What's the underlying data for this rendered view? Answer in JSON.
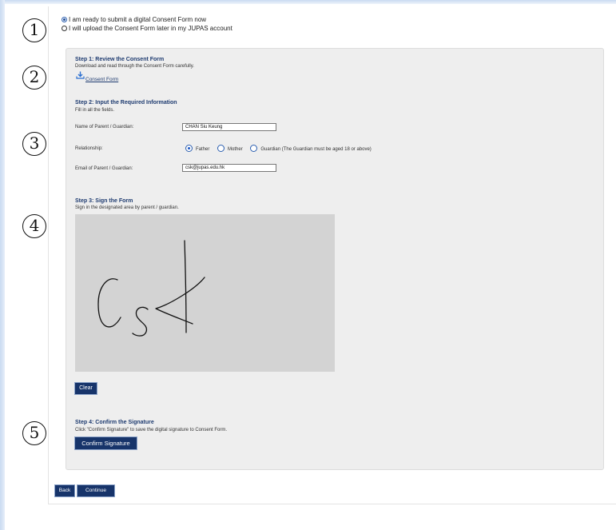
{
  "options": {
    "submit_now": "I am ready to submit a digital Consent Form now",
    "upload_later": "I will upload the Consent Form later in my JUPAS account"
  },
  "markers": [
    "1",
    "2",
    "3",
    "4",
    "5"
  ],
  "step1": {
    "title": "Step 1: Review the Consent Form",
    "desc": "Download and read through the Consent Form carefully.",
    "link": "Consent Form",
    "icon": "download-icon"
  },
  "step2": {
    "title": "Step 2: Input the Required Information",
    "desc": "Fill in all the fields.",
    "name_label": "Name of Parent / Guardian:",
    "name_value": "CHAN Siu Keung",
    "relationship_label": "Relationship:",
    "relationship_options": [
      "Father",
      "Mother",
      "Guardian (The Guardian must be aged 18 or above)"
    ],
    "relationship_selected": "Father",
    "email_label": "Email of Parent / Guardian:",
    "email_value": "csk@jupas.edu.hk"
  },
  "step3": {
    "title": "Step 3: Sign the Form",
    "desc": "Sign in the designated area by parent / guardian.",
    "clear_label": "Clear"
  },
  "step4": {
    "title": "Step 4: Confirm the Signature",
    "desc": "Click \"Confirm Signature\" to save the digital signature to Consent Form.",
    "confirm_label": "Confirm Signature"
  },
  "nav": {
    "back_label": "Back",
    "continue_label": "Continue"
  },
  "colors": {
    "button_bg": "#17346a",
    "heading": "#1e3b70",
    "panel_bg": "#eeeeee",
    "signature_pad": "#d3d3d3"
  }
}
